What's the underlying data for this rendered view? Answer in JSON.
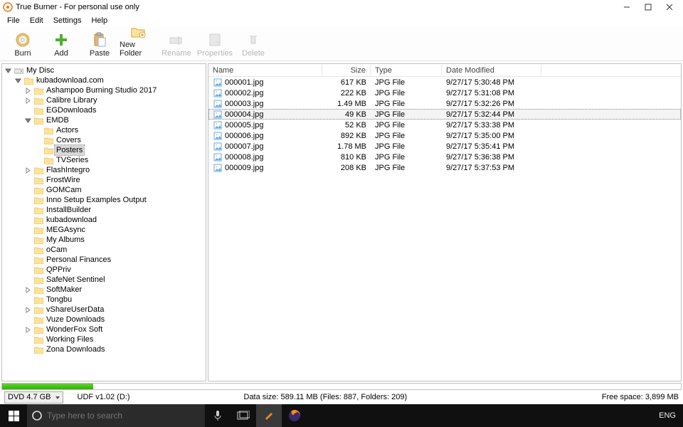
{
  "window": {
    "title": "True Burner - For personal use only"
  },
  "menu": [
    "File",
    "Edit",
    "Settings",
    "Help"
  ],
  "toolbar": [
    {
      "id": "burn",
      "label": "Burn",
      "enabled": true
    },
    {
      "id": "add",
      "label": "Add",
      "enabled": true
    },
    {
      "id": "paste",
      "label": "Paste",
      "enabled": true
    },
    {
      "id": "newfolder",
      "label": "New Folder",
      "enabled": true
    },
    {
      "id": "rename",
      "label": "Rename",
      "enabled": false
    },
    {
      "id": "properties",
      "label": "Properties",
      "enabled": false
    },
    {
      "id": "delete",
      "label": "Delete",
      "enabled": false
    }
  ],
  "tree": {
    "root": "My Disc",
    "nodes": [
      {
        "depth": 0,
        "expander": "minus",
        "icon": "drive",
        "label": "My Disc"
      },
      {
        "depth": 1,
        "expander": "minus",
        "icon": "folder",
        "label": "kubadownload.com"
      },
      {
        "depth": 2,
        "expander": "plus",
        "icon": "folder",
        "label": "Ashampoo Burning Studio 2017"
      },
      {
        "depth": 2,
        "expander": "plus",
        "icon": "folder",
        "label": "Calibre Library"
      },
      {
        "depth": 2,
        "expander": "none",
        "icon": "folder",
        "label": "EGDownloads"
      },
      {
        "depth": 2,
        "expander": "minus",
        "icon": "folder",
        "label": "EMDB"
      },
      {
        "depth": 3,
        "expander": "none",
        "icon": "folder",
        "label": "Actors"
      },
      {
        "depth": 3,
        "expander": "none",
        "icon": "folder",
        "label": "Covers"
      },
      {
        "depth": 3,
        "expander": "none",
        "icon": "folder",
        "label": "Posters",
        "selected": true
      },
      {
        "depth": 3,
        "expander": "none",
        "icon": "folder",
        "label": "TVSeries"
      },
      {
        "depth": 2,
        "expander": "plus",
        "icon": "folder",
        "label": "FlashIntegro"
      },
      {
        "depth": 2,
        "expander": "none",
        "icon": "folder",
        "label": "FrostWire"
      },
      {
        "depth": 2,
        "expander": "none",
        "icon": "folder",
        "label": "GOMCam"
      },
      {
        "depth": 2,
        "expander": "none",
        "icon": "folder",
        "label": "Inno Setup Examples Output"
      },
      {
        "depth": 2,
        "expander": "none",
        "icon": "folder",
        "label": "InstallBuilder"
      },
      {
        "depth": 2,
        "expander": "none",
        "icon": "folder",
        "label": "kubadownload"
      },
      {
        "depth": 2,
        "expander": "none",
        "icon": "folder",
        "label": "MEGAsync"
      },
      {
        "depth": 2,
        "expander": "none",
        "icon": "folder",
        "label": "My Albums"
      },
      {
        "depth": 2,
        "expander": "none",
        "icon": "folder",
        "label": "oCam"
      },
      {
        "depth": 2,
        "expander": "none",
        "icon": "folder",
        "label": "Personal Finances"
      },
      {
        "depth": 2,
        "expander": "none",
        "icon": "folder",
        "label": "QPPriv"
      },
      {
        "depth": 2,
        "expander": "none",
        "icon": "folder",
        "label": "SafeNet Sentinel"
      },
      {
        "depth": 2,
        "expander": "plus",
        "icon": "folder",
        "label": "SoftMaker"
      },
      {
        "depth": 2,
        "expander": "none",
        "icon": "folder",
        "label": "Tongbu"
      },
      {
        "depth": 2,
        "expander": "plus",
        "icon": "folder",
        "label": "vShareUserData"
      },
      {
        "depth": 2,
        "expander": "none",
        "icon": "folder",
        "label": "Vuze Downloads"
      },
      {
        "depth": 2,
        "expander": "plus",
        "icon": "folder",
        "label": "WonderFox Soft"
      },
      {
        "depth": 2,
        "expander": "none",
        "icon": "folder",
        "label": "Working Files"
      },
      {
        "depth": 2,
        "expander": "none",
        "icon": "folder",
        "label": "Zona Downloads"
      }
    ]
  },
  "file_columns": [
    "Name",
    "Size",
    "Type",
    "Date Modified"
  ],
  "files": [
    {
      "name": "000001.jpg",
      "size": "617 KB",
      "type": "JPG File",
      "date": "9/27/17 5:30:48 PM"
    },
    {
      "name": "000002.jpg",
      "size": "222 KB",
      "type": "JPG File",
      "date": "9/27/17 5:31:08 PM"
    },
    {
      "name": "000003.jpg",
      "size": "1.49 MB",
      "type": "JPG File",
      "date": "9/27/17 5:32:26 PM"
    },
    {
      "name": "000004.jpg",
      "size": "49 KB",
      "type": "JPG File",
      "date": "9/27/17 5:32:44 PM",
      "selected": true
    },
    {
      "name": "000005.jpg",
      "size": "52 KB",
      "type": "JPG File",
      "date": "9/27/17 5:33:38 PM"
    },
    {
      "name": "000006.jpg",
      "size": "892 KB",
      "type": "JPG File",
      "date": "9/27/17 5:35:00 PM"
    },
    {
      "name": "000007.jpg",
      "size": "1.78 MB",
      "type": "JPG File",
      "date": "9/27/17 5:35:41 PM"
    },
    {
      "name": "000008.jpg",
      "size": "810 KB",
      "type": "JPG File",
      "date": "9/27/17 5:36:38 PM"
    },
    {
      "name": "000009.jpg",
      "size": "208 KB",
      "type": "JPG File",
      "date": "9/27/17 5:37:53 PM"
    }
  ],
  "status": {
    "disk_type": "DVD 4.7 GB",
    "volume": "UDF v1.02 (D:)",
    "data_size": "Data size: 589.11 MB (Files: 887, Folders: 209)",
    "free_space": "Free space: 3,899 MB"
  },
  "taskbar": {
    "search_placeholder": "Type here to search",
    "lang": "ENG"
  }
}
